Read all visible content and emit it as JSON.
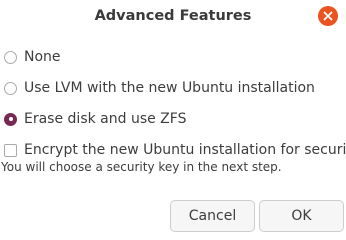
{
  "dialog": {
    "title": "Advanced Features"
  },
  "options": [
    {
      "label": "None",
      "checked": false
    },
    {
      "label": "Use LVM with the new Ubuntu installation",
      "checked": false
    },
    {
      "label": "Erase disk and use ZFS",
      "checked": true
    }
  ],
  "encrypt": {
    "label": "Encrypt the new Ubuntu installation for security",
    "checked": false,
    "hint": "You will choose a security key in the next step."
  },
  "buttons": {
    "cancel_label": "Cancel",
    "ok_label": "OK"
  },
  "colors": {
    "accent": "#772953",
    "close": "#e95420"
  }
}
